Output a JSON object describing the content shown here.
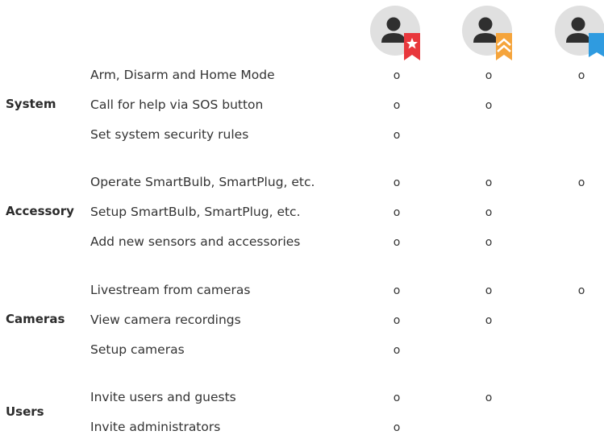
{
  "roles": [
    {
      "badge": "star-badge-icon",
      "color": "#e8373c"
    },
    {
      "badge": "chevron-badge-icon",
      "color": "#f5a43b"
    },
    {
      "badge": "bookmark-badge-icon",
      "color": "#2f9be0"
    }
  ],
  "mark_symbol": "o",
  "groups": [
    {
      "name": "System",
      "permissions": [
        {
          "label": "Arm, Disarm and Home Mode",
          "access": [
            true,
            true,
            true
          ]
        },
        {
          "label": "Call for help via SOS button",
          "access": [
            true,
            true,
            false
          ]
        },
        {
          "label": "Set system security rules",
          "access": [
            true,
            false,
            false
          ]
        }
      ]
    },
    {
      "name": "Accessory",
      "permissions": [
        {
          "label": "Operate SmartBulb, SmartPlug, etc.",
          "access": [
            true,
            true,
            true
          ]
        },
        {
          "label": "Setup SmartBulb, SmartPlug, etc.",
          "access": [
            true,
            true,
            false
          ]
        },
        {
          "label": "Add new sensors and accessories",
          "access": [
            true,
            true,
            false
          ]
        }
      ]
    },
    {
      "name": "Cameras",
      "permissions": [
        {
          "label": "Livestream from cameras",
          "access": [
            true,
            true,
            true
          ]
        },
        {
          "label": "View camera recordings",
          "access": [
            true,
            true,
            false
          ]
        },
        {
          "label": "Setup cameras",
          "access": [
            true,
            false,
            false
          ]
        }
      ]
    },
    {
      "name": "Users",
      "permissions": [
        {
          "label": "Invite users and guests",
          "access": [
            true,
            true,
            false
          ]
        },
        {
          "label": "Invite administrators",
          "access": [
            true,
            false,
            false
          ]
        }
      ]
    }
  ]
}
